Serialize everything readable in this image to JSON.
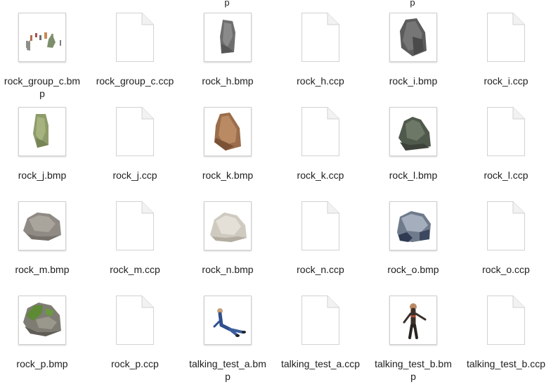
{
  "top_fragments": [
    "p",
    "p"
  ],
  "files": [
    {
      "name": "rock_group_c.bmp",
      "line1": "rock_group_c.bm",
      "line2": "p",
      "kind": "bmp",
      "icon": "rock-group-thumbnail"
    },
    {
      "name": "rock_group_c.ccp",
      "line1": "rock_group_c.ccp",
      "line2": "",
      "kind": "ccp",
      "icon": "document-icon"
    },
    {
      "name": "rock_h.bmp",
      "line1": "rock_h.bmp",
      "line2": "",
      "kind": "bmp",
      "icon": "gray-rock-thumbnail"
    },
    {
      "name": "rock_h.ccp",
      "line1": "rock_h.ccp",
      "line2": "",
      "kind": "ccp",
      "icon": "document-icon"
    },
    {
      "name": "rock_i.bmp",
      "line1": "rock_i.bmp",
      "line2": "",
      "kind": "bmp",
      "icon": "dark-rock-thumbnail"
    },
    {
      "name": "rock_i.ccp",
      "line1": "rock_i.ccp",
      "line2": "",
      "kind": "ccp",
      "icon": "document-icon"
    },
    {
      "name": "rock_j.bmp",
      "line1": "rock_j.bmp",
      "line2": "",
      "kind": "bmp",
      "icon": "mossy-rock-thumbnail"
    },
    {
      "name": "rock_j.ccp",
      "line1": "rock_j.ccp",
      "line2": "",
      "kind": "ccp",
      "icon": "document-icon"
    },
    {
      "name": "rock_k.bmp",
      "line1": "rock_k.bmp",
      "line2": "",
      "kind": "bmp",
      "icon": "brown-rock-thumbnail"
    },
    {
      "name": "rock_k.ccp",
      "line1": "rock_k.ccp",
      "line2": "",
      "kind": "ccp",
      "icon": "document-icon"
    },
    {
      "name": "rock_l.bmp",
      "line1": "rock_l.bmp",
      "line2": "",
      "kind": "bmp",
      "icon": "dark-rock-thumbnail"
    },
    {
      "name": "rock_l.ccp",
      "line1": "rock_l.ccp",
      "line2": "",
      "kind": "ccp",
      "icon": "document-icon"
    },
    {
      "name": "rock_m.bmp",
      "line1": "rock_m.bmp",
      "line2": "",
      "kind": "bmp",
      "icon": "gray-boulder-thumbnail"
    },
    {
      "name": "rock_m.ccp",
      "line1": "rock_m.ccp",
      "line2": "",
      "kind": "ccp",
      "icon": "document-icon"
    },
    {
      "name": "rock_n.bmp",
      "line1": "rock_n.bmp",
      "line2": "",
      "kind": "bmp",
      "icon": "white-rock-thumbnail"
    },
    {
      "name": "rock_n.ccp",
      "line1": "rock_n.ccp",
      "line2": "",
      "kind": "ccp",
      "icon": "document-icon"
    },
    {
      "name": "rock_o.bmp",
      "line1": "rock_o.bmp",
      "line2": "",
      "kind": "bmp",
      "icon": "blue-rock-thumbnail"
    },
    {
      "name": "rock_o.ccp",
      "line1": "rock_o.ccp",
      "line2": "",
      "kind": "ccp",
      "icon": "document-icon"
    },
    {
      "name": "rock_p.bmp",
      "line1": "rock_p.bmp",
      "line2": "",
      "kind": "bmp",
      "icon": "mossy-boulder-thumbnail"
    },
    {
      "name": "rock_p.ccp",
      "line1": "rock_p.ccp",
      "line2": "",
      "kind": "ccp",
      "icon": "document-icon"
    },
    {
      "name": "talking_test_a.bmp",
      "line1": "talking_test_a.bm",
      "line2": "p",
      "kind": "bmp",
      "icon": "reclining-figure-thumbnail"
    },
    {
      "name": "talking_test_a.ccp",
      "line1": "talking_test_a.ccp",
      "line2": "",
      "kind": "ccp",
      "icon": "document-icon"
    },
    {
      "name": "talking_test_b.bmp",
      "line1": "talking_test_b.bm",
      "line2": "p",
      "kind": "bmp",
      "icon": "standing-figure-thumbnail"
    },
    {
      "name": "talking_test_b.ccp",
      "line1": "talking_test_b.ccp",
      "line2": "",
      "kind": "ccp",
      "icon": "document-icon"
    }
  ]
}
